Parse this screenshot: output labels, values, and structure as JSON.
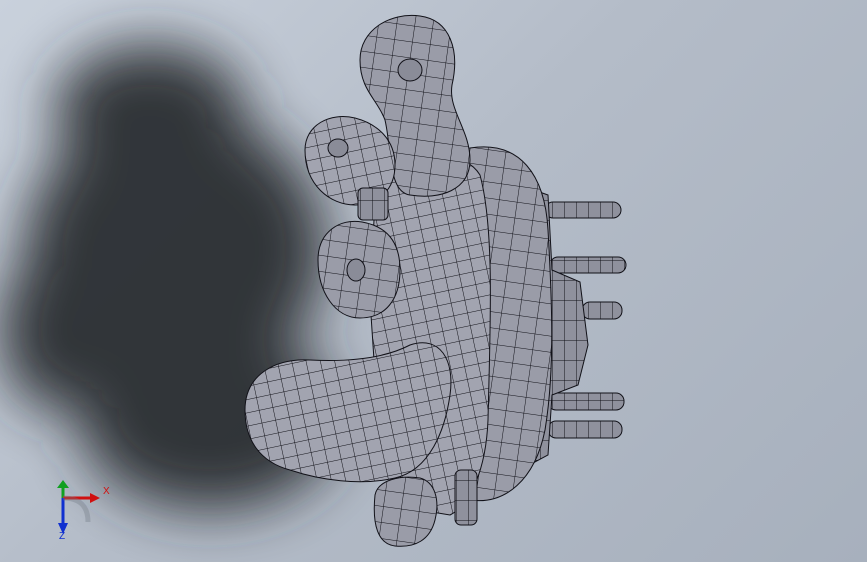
{
  "viewport": {
    "background_top": "#c9d1dc",
    "background_bottom": "#a7b0bd"
  },
  "model": {
    "fill": "#9a9ca8",
    "mesh_color": "#101018",
    "shadow_color": "#2b2e33"
  },
  "triad": {
    "x_label": "X",
    "z_label": "Z",
    "x_color": "#d01010",
    "y_color": "#10a020",
    "z_color": "#1030d0"
  }
}
